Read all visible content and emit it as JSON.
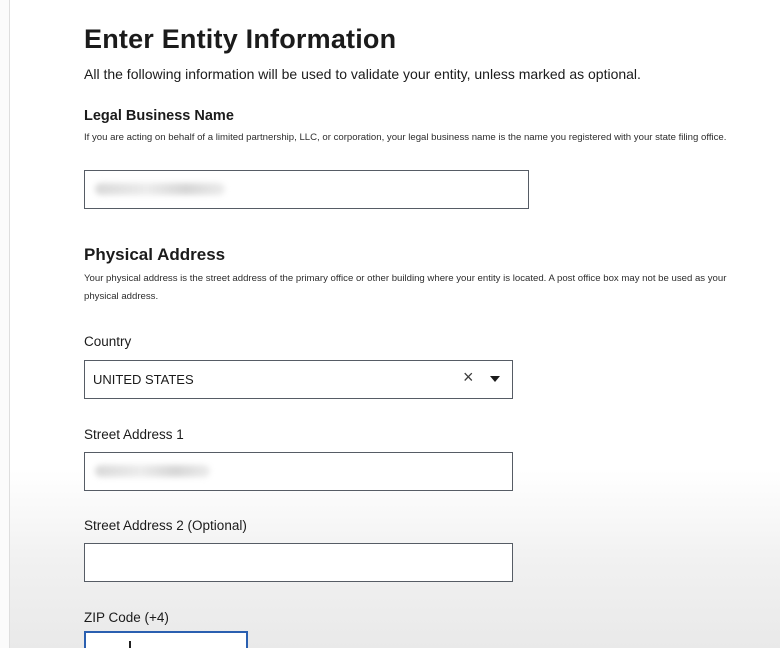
{
  "page": {
    "title": "Enter Entity Information",
    "intro": "All the following information will be used to validate your entity, unless marked as optional."
  },
  "legal_business_name": {
    "label": "Legal Business Name",
    "hint": "If you are acting on behalf of a limited partnership, LLC, or corporation, your legal business name is the name you registered with your state filing office."
  },
  "physical_address": {
    "title": "Physical Address",
    "hint": "Your physical address is the street address of the primary office or other building where your entity is located. A post office box may not be used as your physical address.",
    "country": {
      "label": "Country",
      "value": "UNITED STATES",
      "clear_glyph": "×"
    },
    "street_1": {
      "label": "Street Address 1"
    },
    "street_2": {
      "label": "Street Address 2 (Optional)",
      "value": ""
    },
    "zip": {
      "label": "ZIP Code (+4)"
    }
  },
  "colors": {
    "text": "#1b1b1b",
    "input_border": "#565c65",
    "focus_border": "#2a5fb0"
  }
}
